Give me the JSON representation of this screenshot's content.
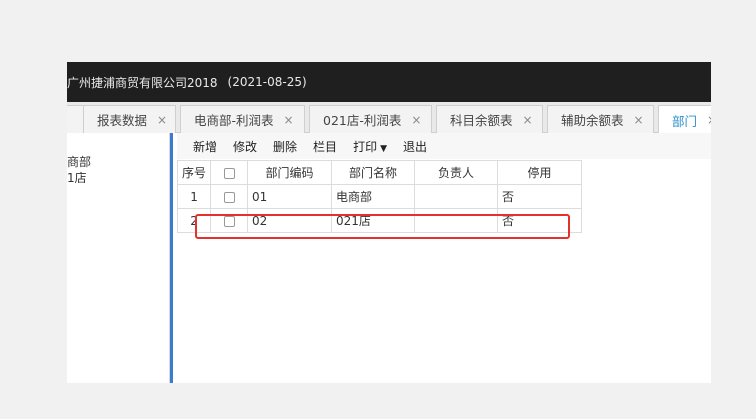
{
  "window": {
    "title": "广州捷浦商贸有限公司2018",
    "date": "(2021-08-25)"
  },
  "tabs": [
    {
      "label": "",
      "closable": false
    },
    {
      "label": "报表数据",
      "closable": true
    },
    {
      "label": "电商部-利润表",
      "closable": true
    },
    {
      "label": "021店-利润表",
      "closable": true
    },
    {
      "label": "科目余额表",
      "closable": true
    },
    {
      "label": "辅助余额表",
      "closable": true
    },
    {
      "label": "部门",
      "closable": true,
      "active": true
    }
  ],
  "close_glyph": "×",
  "tree": [
    "商部",
    "1店"
  ],
  "toolbar": {
    "add": "新增",
    "edit": "修改",
    "delete": "删除",
    "columns": "栏目",
    "print": "打印",
    "exit": "退出"
  },
  "table": {
    "headers": [
      "序号",
      "",
      "部门编码",
      "部门名称",
      "负责人",
      "停用"
    ],
    "rows": [
      {
        "index": "1",
        "code": "01",
        "name": "电商部",
        "manager": "",
        "disabled": "否"
      },
      {
        "index": "2",
        "code": "02",
        "name": "021店",
        "manager": "",
        "disabled": "否"
      }
    ]
  },
  "colors": {
    "highlight": "#e4312d",
    "active_tab": "#2b8fc9",
    "splitter": "#3a7ccf"
  }
}
